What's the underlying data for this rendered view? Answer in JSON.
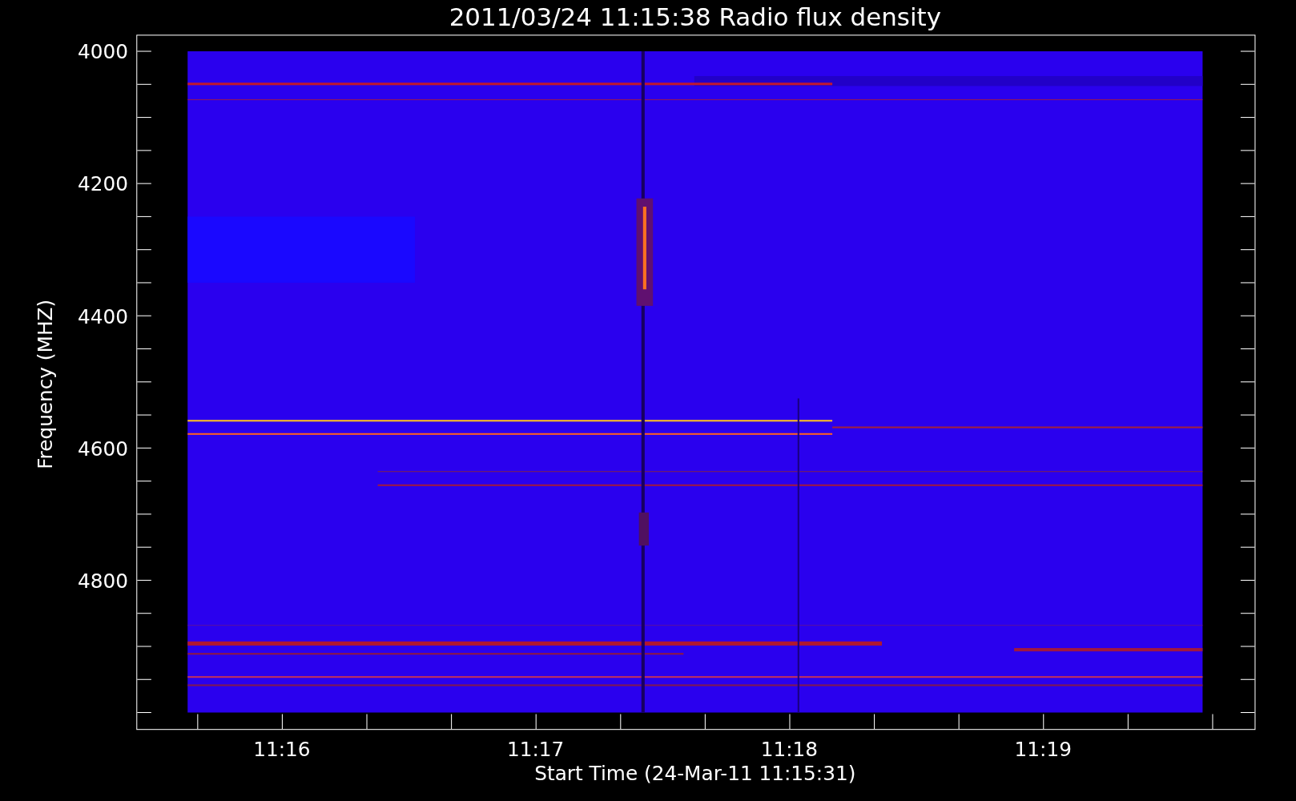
{
  "chart": {
    "title": "2011/03/24 11:15:38 Radio flux density",
    "ylabel": "Frequency (MHZ)",
    "xlabel": "Start Time (24-Mar-11 11:15:31)",
    "yticks": [
      "4000",
      "4200",
      "4400",
      "4600",
      "4800"
    ],
    "xticks": [
      "11:16",
      "11:17",
      "11:18",
      "11:19"
    ]
  }
}
